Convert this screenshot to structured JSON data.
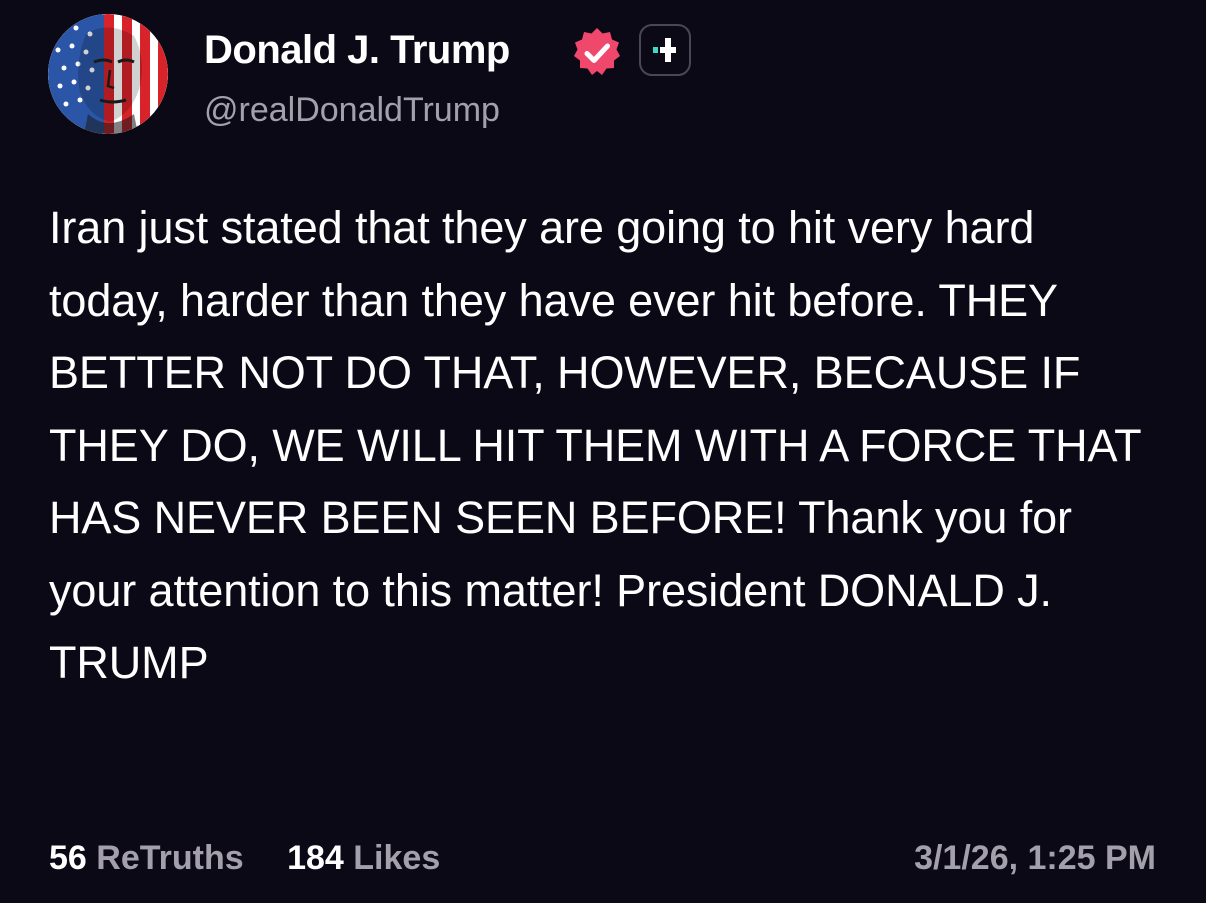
{
  "author": {
    "display_name": "Donald J. Trump",
    "handle": "@realDonaldTrump",
    "avatar_icon": "flag-painted-face-avatar",
    "verified_icon": "verified-badge-icon",
    "plus_icon": "plus-badge-icon"
  },
  "post": {
    "text": "Iran just stated that they are going to hit very hard today, harder than they have ever hit before. THEY BETTER NOT DO THAT, HOWEVER, BECAUSE IF THEY DO, WE WILL HIT THEM WITH A FORCE THAT HAS NEVER BEEN SEEN BEFORE! Thank you for your attention to this matter! President DONALD J. TRUMP"
  },
  "stats": {
    "retruths_count": "56",
    "retruths_label": "ReTruths",
    "likes_count": "184",
    "likes_label": "Likes",
    "timestamp": "3/1/26, 1:25 PM"
  },
  "colors": {
    "background": "#0c0917",
    "text_primary": "#ffffff",
    "text_secondary": "#a3a0ac",
    "verified_badge": "#f0486c",
    "plus_accent": "#3ddbc3"
  }
}
